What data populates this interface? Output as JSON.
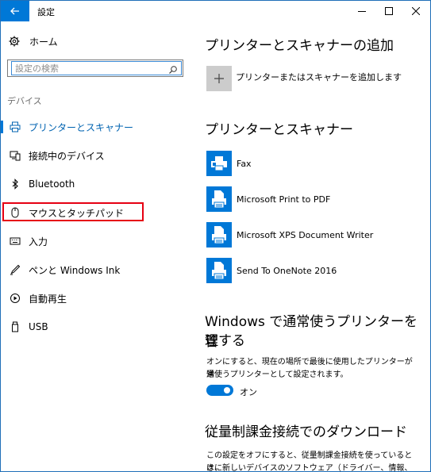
{
  "window": {
    "title": "設定"
  },
  "sidebar": {
    "home_label": "ホーム",
    "search_placeholder": "設定の検索",
    "section_label": "デバイス",
    "items": [
      {
        "label": "プリンターとスキャナー",
        "icon": "printer-icon",
        "active": true
      },
      {
        "label": "接続中のデバイス",
        "icon": "devices-icon",
        "active": false
      },
      {
        "label": "Bluetooth",
        "icon": "bluetooth-icon",
        "active": false
      },
      {
        "label": "マウスとタッチパッド",
        "icon": "mouse-icon",
        "active": false,
        "highlighted": true
      },
      {
        "label": "入力",
        "icon": "keyboard-icon",
        "active": false
      },
      {
        "label": "ペンと Windows Ink",
        "icon": "pen-icon",
        "active": false
      },
      {
        "label": "自動再生",
        "icon": "autoplay-icon",
        "active": false
      },
      {
        "label": "USB",
        "icon": "usb-icon",
        "active": false
      }
    ]
  },
  "main": {
    "add_heading": "プリンターとスキャナーの追加",
    "add_button_label": "プリンターまたはスキャナーを追加します",
    "printers_heading": "プリンターとスキャナー",
    "printers": [
      {
        "name": "Fax",
        "icon": "fax-icon"
      },
      {
        "name": "Microsoft Print to PDF",
        "icon": "printer-doc-icon"
      },
      {
        "name": "Microsoft XPS Document Writer",
        "icon": "printer-doc-icon"
      },
      {
        "name": "Send To OneNote 2016",
        "icon": "printer-doc-icon"
      }
    ],
    "default_heading_line1": "Windows で通常使うプリンターを管",
    "default_heading_line2": "理する",
    "default_desc_line1": "オンにすると、現在の場所で最後に使用したプリンターが通",
    "default_desc_line2": "常使うプリンターとして設定されます。",
    "toggle_label": "オン",
    "toggle_on": true,
    "metered_heading": "従量制課金接続でのダウンロード",
    "metered_desc_line1": "この設定をオフにすると、従量制課金接続を使っているときに",
    "metered_desc_line2": "は、新しいデバイスのソフトウェア（ドライバー、情報、アプリ）"
  },
  "colors": {
    "accent": "#0078d7",
    "highlight_border": "#e60012"
  }
}
